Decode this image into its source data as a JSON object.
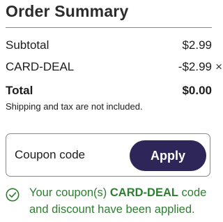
{
  "summary": {
    "title": "Order Summary",
    "rows": [
      {
        "label": "Subtotal",
        "value": "$2.99"
      },
      {
        "label": "CARD-DEAL",
        "value": "-$2.99",
        "remove_glyph": "×"
      }
    ],
    "total": {
      "label": "Total",
      "value": "$0.00"
    },
    "note": "Shipping and tax are not included."
  },
  "coupon": {
    "placeholder": "Coupon code",
    "apply_label": "Apply"
  },
  "success": {
    "icon": "check-circle-icon",
    "prefix": "Your coupon(s) ",
    "code": "CARD-DEAL",
    "suffix": " code and discount have been applied."
  },
  "colors": {
    "button_bg": "#2e2659",
    "success": "#2e7d32",
    "rule": "#8a8a8a"
  }
}
